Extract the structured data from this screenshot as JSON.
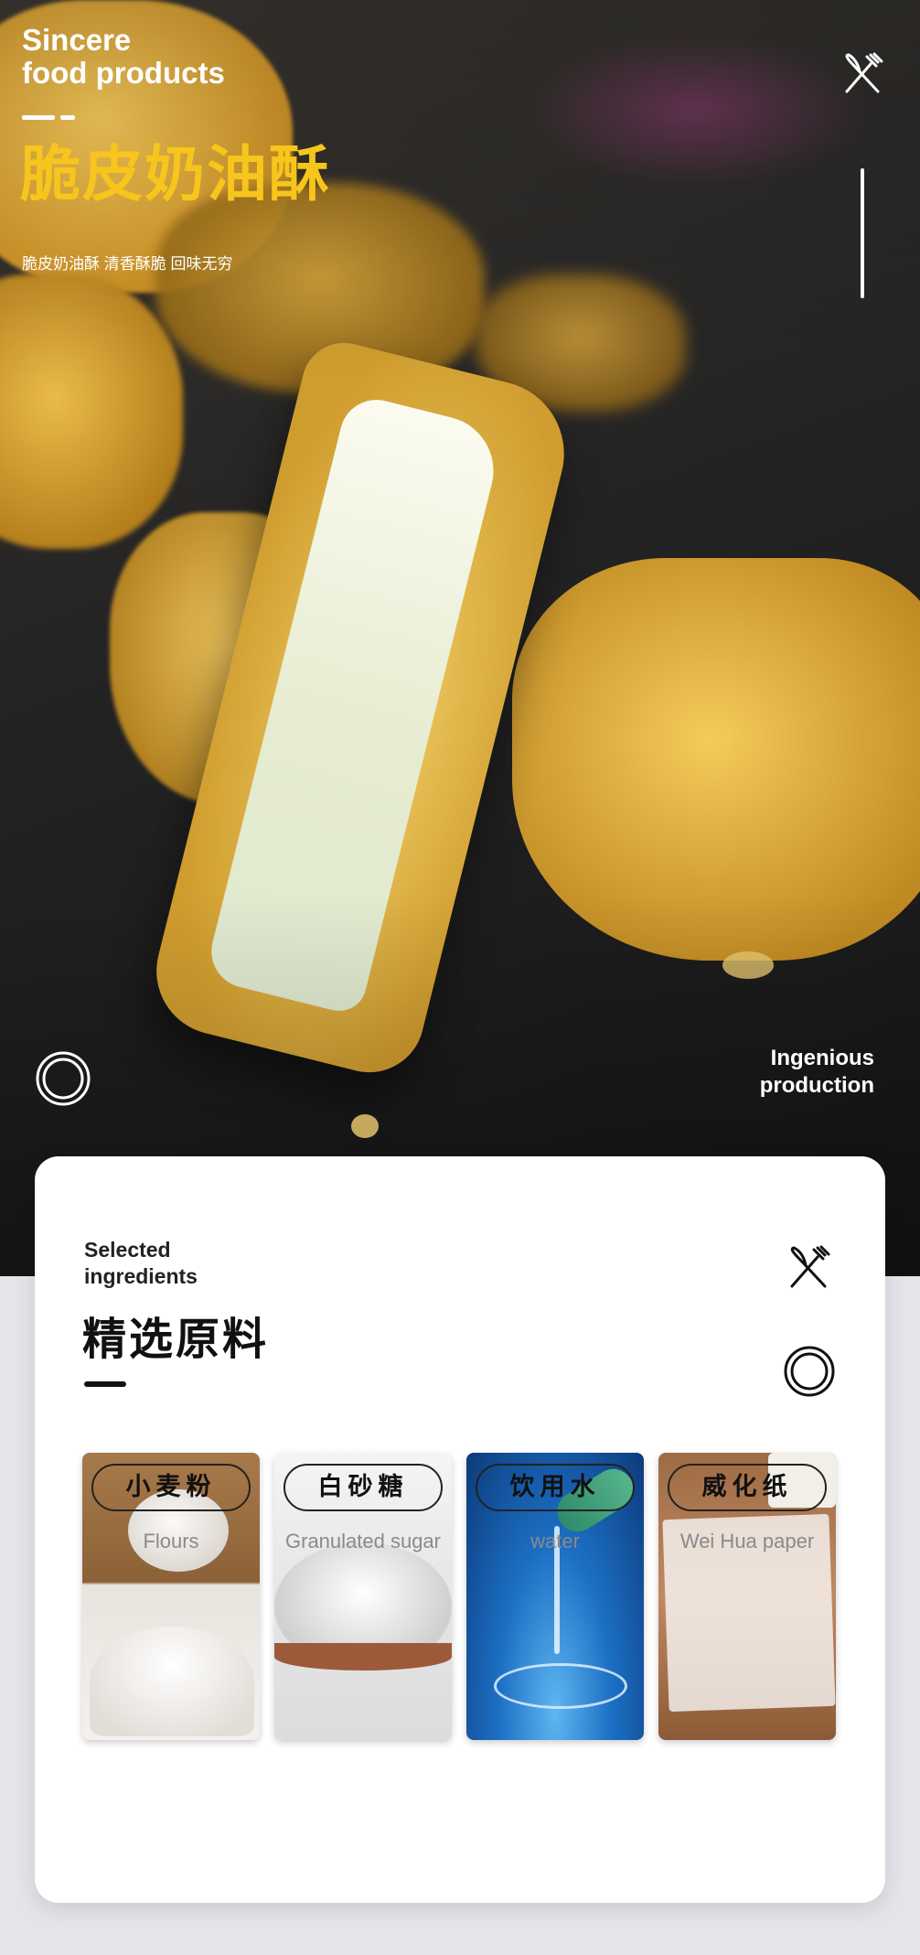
{
  "hero": {
    "brand_line1": "Sincere",
    "brand_line2": "food products",
    "title": "脆皮奶油酥",
    "subtitle": "脆皮奶油酥 清香酥脆 回味无穷",
    "tag_line1": "Ingenious",
    "tag_line2": "production",
    "icons": [
      "fork-knife-icon",
      "ring-icon"
    ],
    "title_color": "#f7c51c"
  },
  "card": {
    "en_line1": "Selected",
    "en_line2": "ingredients",
    "title": "精选原料",
    "icons": [
      "fork-knife-icon",
      "ring-icon"
    ],
    "ingredients": [
      {
        "zh": "小麦粉",
        "en": "Flours"
      },
      {
        "zh": "白砂糖",
        "en": "Granulated sugar"
      },
      {
        "zh": "饮用水",
        "en": "water"
      },
      {
        "zh": "威化纸",
        "en": "Wei Hua paper"
      }
    ]
  }
}
